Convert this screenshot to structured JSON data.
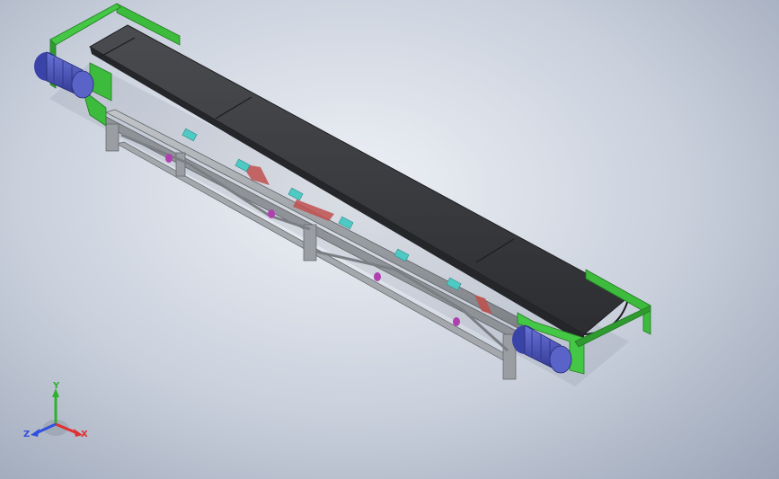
{
  "colors": {
    "background_center": "#eef1f6",
    "background_edge": "#9aa4b6",
    "belt": "#3a3c3f",
    "frame": "#9ea1a5",
    "end_bracket": "#3dbb3d",
    "motor": "#4a55b8",
    "roller_bracket": "#4ec9c4",
    "cross_brace": "#c0504d",
    "idler_dot": "#b040b0",
    "axis_x": "#e03030",
    "axis_y": "#30b030",
    "axis_z": "#3050e0"
  },
  "view_triad": {
    "x_label": "X",
    "y_label": "Y",
    "z_label": "Z"
  },
  "model": {
    "components": [
      "belt",
      "frame",
      "end-bracket",
      "drive-motor",
      "roller-bracket",
      "cross-brace",
      "idler"
    ],
    "motor_count": 2,
    "end_bracket_count": 2
  }
}
